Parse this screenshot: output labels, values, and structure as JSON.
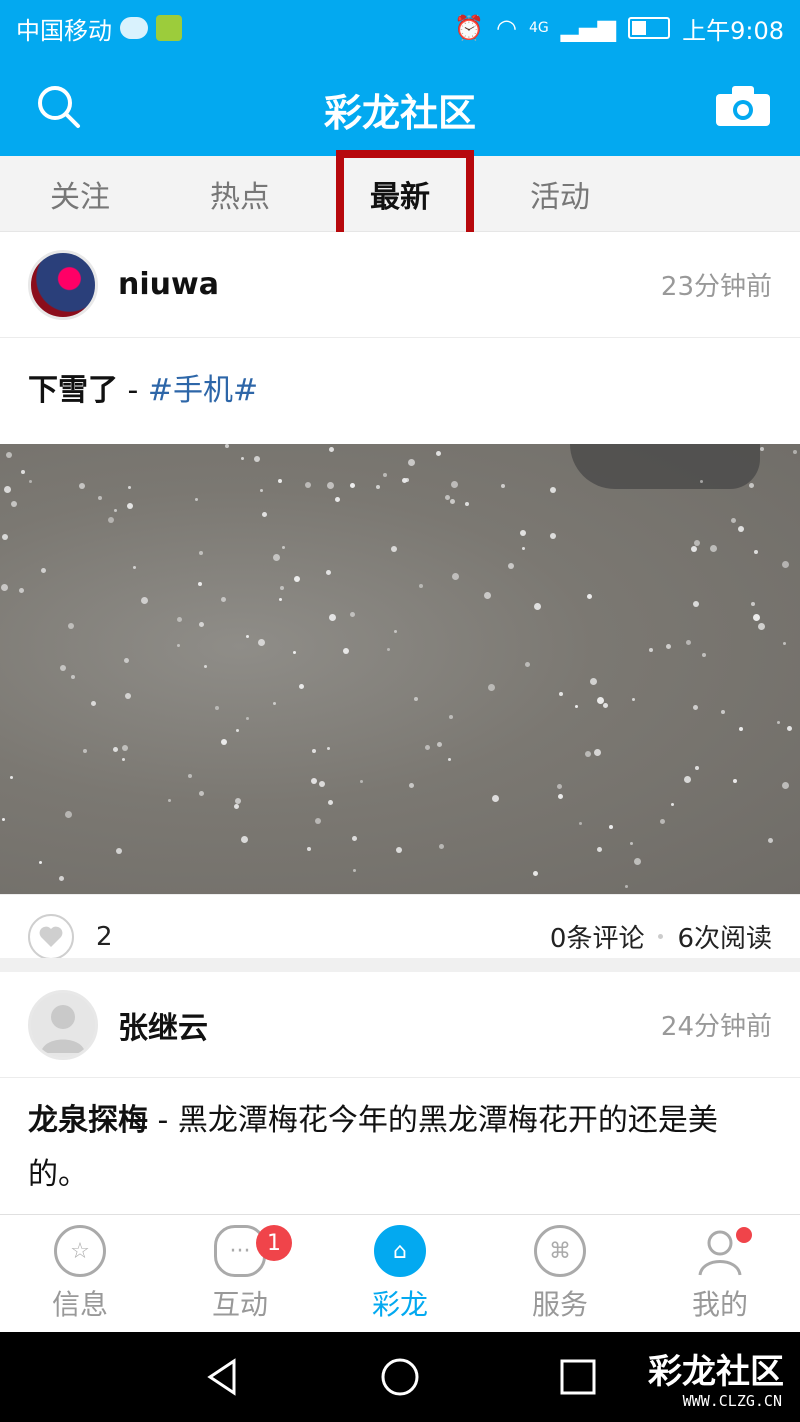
{
  "statusbar": {
    "carrier": "中国移动",
    "network": "4G",
    "time": "上午9:08"
  },
  "header": {
    "title": "彩龙社区",
    "search_icon": "search-icon",
    "camera_icon": "camera-icon"
  },
  "tabs": {
    "items": [
      "关注",
      "热点",
      "最新",
      "活动"
    ],
    "active_index": 2
  },
  "posts": [
    {
      "author": "niuwa",
      "time": "23分钟前",
      "title": "下雪了",
      "separator": " - ",
      "topic": "#手机#",
      "likes": "2",
      "comments": "0条评论",
      "reads": "6次阅读"
    },
    {
      "author": "张继云",
      "time": "24分钟前",
      "title": "龙泉探梅",
      "separator": " - ",
      "content": "黑龙潭梅花今年的黑龙潭梅花开的还是美的。"
    }
  ],
  "bottom_nav": {
    "items": [
      {
        "label": "信息",
        "icon": "star-icon"
      },
      {
        "label": "互动",
        "icon": "chat-icon",
        "badge": "1"
      },
      {
        "label": "彩龙",
        "icon": "home-icon"
      },
      {
        "label": "服务",
        "icon": "grid-icon"
      },
      {
        "label": "我的",
        "icon": "user-icon"
      }
    ]
  },
  "watermark": {
    "text": "彩龙社区",
    "url": "WWW.CLZG.CN"
  },
  "colors": {
    "brand": "#03a9f0",
    "highlight": "#b7080c",
    "badge": "#f0444a",
    "topic": "#2d66a8"
  }
}
